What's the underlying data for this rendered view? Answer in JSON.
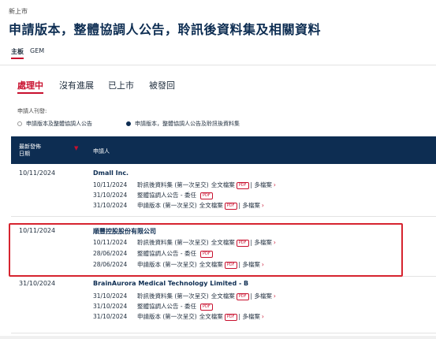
{
  "breadcrumb": "新上市",
  "page_title": "申請版本，整體協調人公告，聆訊後資料集及相關資料",
  "board_tabs": [
    {
      "label": "主板",
      "active": true
    },
    {
      "label": "GEM",
      "active": false
    }
  ],
  "status_tabs": [
    {
      "label": "處理中",
      "active": true
    },
    {
      "label": "沒有進展",
      "active": false
    },
    {
      "label": "已上市",
      "active": false
    },
    {
      "label": "被發回",
      "active": false
    }
  ],
  "filter": {
    "label": "申請人刊發:",
    "options": [
      {
        "label": "申請版本及整體協調人公告",
        "selected": false
      },
      {
        "label": "申請版本，整體協調人公告及聆訊後資料集",
        "selected": true
      }
    ]
  },
  "table": {
    "col_date": "最新發佈",
    "col_date_2": "日期",
    "col_applicant": "申請人",
    "sort_indicator": "▼",
    "rows": [
      {
        "date": "10/11/2024",
        "applicant": "Dmall Inc.",
        "docs": [
          {
            "date": "10/11/2024",
            "title": "聆訊後資料集 (第一次呈交)",
            "full": "全文檔案",
            "pdf": "PDF",
            "sep": "|",
            "multi": "多檔案",
            "chev": "›"
          },
          {
            "date": "31/10/2024",
            "title": "整體協調人公告 - 委任",
            "pdf": "PDF"
          },
          {
            "date": "31/10/2024",
            "title": "申請版本 (第一次呈交)",
            "full": "全文檔案",
            "pdf": "PDF",
            "sep": "|",
            "multi": "多檔案",
            "chev": "›"
          }
        ]
      },
      {
        "date": "10/11/2024",
        "applicant": "順豐控股股份有限公司",
        "docs": [
          {
            "date": "10/11/2024",
            "title": "聆訊後資料集 (第一次呈交)",
            "full": "全文檔案",
            "pdf": "PDF",
            "sep": "|",
            "multi": "多檔案",
            "chev": "›"
          },
          {
            "date": "28/06/2024",
            "title": "整體協調人公告 - 委任",
            "pdf": "PDF"
          },
          {
            "date": "28/06/2024",
            "title": "申請版本 (第一次呈交)",
            "full": "全文檔案",
            "pdf": "PDF",
            "sep": "|",
            "multi": "多檔案",
            "chev": "›"
          }
        ]
      },
      {
        "date": "31/10/2024",
        "applicant": "BrainAurora Medical Technology Limited - B",
        "docs": [
          {
            "date": "31/10/2024",
            "title": "聆訊後資料集 (第一次呈交)",
            "full": "全文檔案",
            "pdf": "PDF",
            "sep": "|",
            "multi": "多檔案",
            "chev": "›"
          },
          {
            "date": "31/10/2024",
            "title": "整體協調人公告 - 委任",
            "pdf": "PDF"
          },
          {
            "date": "31/10/2024",
            "title": "申請版本 (第一次呈交)",
            "full": "全文檔案",
            "pdf": "PDF",
            "sep": "|",
            "multi": "多檔案",
            "chev": "›"
          }
        ]
      }
    ]
  },
  "colors": {
    "navy": "#0d2d52",
    "accent_red": "#c8102e",
    "highlight_box": "#d6242f"
  }
}
